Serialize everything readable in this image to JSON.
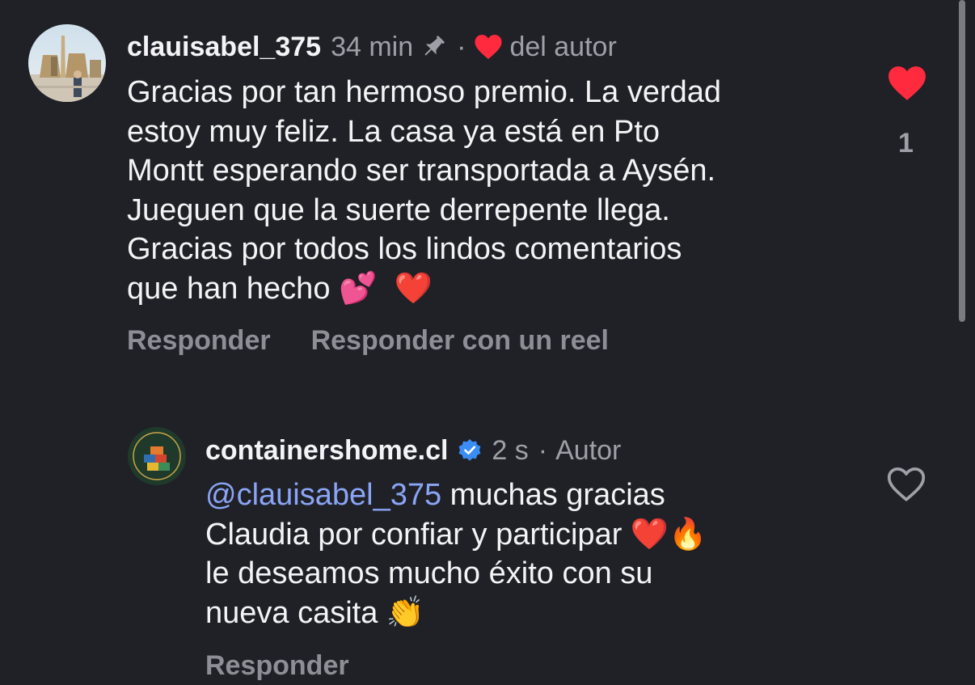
{
  "comments": [
    {
      "username": "clauisabel_375",
      "time": "34 min",
      "separator": "·",
      "author_like_label": "del autor",
      "text": "Gracias por tan hermoso premio. La verdad\nestoy muy feliz. La casa ya está en Pto\nMontt esperando ser transportada a Aysén.\nJueguen que la suerte derrepente llega.\nGracias por todos los lindos comentarios\nque han hecho 💕  ❤️",
      "actions": [
        "Responder",
        "Responder con un reel"
      ],
      "like_count": "1",
      "liked": true,
      "icons": [
        "pin-icon",
        "heart-icon"
      ]
    },
    {
      "username": "containershome.cl",
      "verified": true,
      "time": "2 s",
      "separator": "·",
      "author_label": "Autor",
      "mention": "@clauisabel_375",
      "text": " muchas gracias\nClaudia por confiar y participar ❤️🔥\nle deseamos mucho éxito con su\nnueva casita 👏",
      "actions": [
        "Responder"
      ],
      "liked": false,
      "icons": [
        "verified-badge-icon",
        "heart-outline-icon"
      ]
    }
  ],
  "colors": {
    "background": "#202127",
    "primary_text": "#f4f4f6",
    "secondary_text": "#9ea0a8",
    "mention": "#8aa5f6",
    "like_red": "#ff2a3d",
    "verified_blue": "#3a8df5"
  }
}
